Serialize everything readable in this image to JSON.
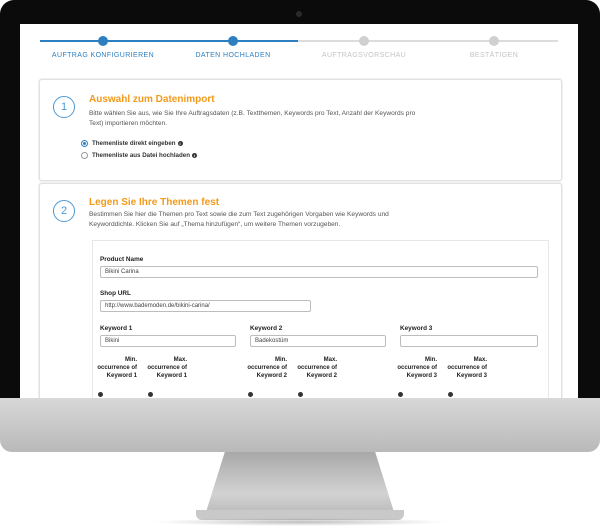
{
  "stepper": {
    "steps": [
      {
        "label": "AUFTRAG KONFIGURIEREN",
        "state": "done"
      },
      {
        "label": "DATEN HOCHLADEN",
        "state": "active"
      },
      {
        "label": "AUFTRAGSVORSCHAU",
        "state": "inactive"
      },
      {
        "label": "BESTÄTIGEN",
        "state": "inactive"
      }
    ]
  },
  "section1": {
    "number": "1",
    "title": "Auswahl zum Datenimport",
    "description": "Bitte wählen Sie aus, wie Sie Ihre Auftragsdaten (z.B. Textthemen, Keywords pro Text, Anzahl der Keywords pro Text) importieren möchten.",
    "options": [
      {
        "label": "Themenliste direkt eingeben",
        "checked": true
      },
      {
        "label": "Themenliste aus Datei hochladen",
        "checked": false
      }
    ]
  },
  "section2": {
    "number": "2",
    "title": "Legen Sie Ihre Themen fest",
    "description": "Bestimmen Sie hier die Themen pro Text sowie die zum Text zugehörigen Vorgaben wie Keywords und Keyworddichte. Klicken Sie auf „Thema hinzufügen“, um weitere Themen vorzugeben.",
    "product_name_label": "Product Name",
    "product_name_value": "Bikini Carina",
    "shop_url_label": "Shop URL",
    "shop_url_value": "http://www.bademoden.de/bikini-carina/",
    "keywords": [
      {
        "label": "Keyword 1",
        "value": "Bikini",
        "min": "Min. occurrence of Keyword 1",
        "max": "Max. occurrence of Keyword 1"
      },
      {
        "label": "Keyword 2",
        "value": "Badekostüm",
        "min": "Min. occurrence of Keyword 2",
        "max": "Max. occurrence of Keyword 2"
      },
      {
        "label": "Keyword 3",
        "value": "",
        "min": "Min. occurrence of Keyword 3",
        "max": "Max. occurrence of Keyword 3"
      }
    ]
  },
  "colors": {
    "accent": "#2e7fc0",
    "title": "#f39a1a",
    "inactive": "#c4c4c4"
  }
}
